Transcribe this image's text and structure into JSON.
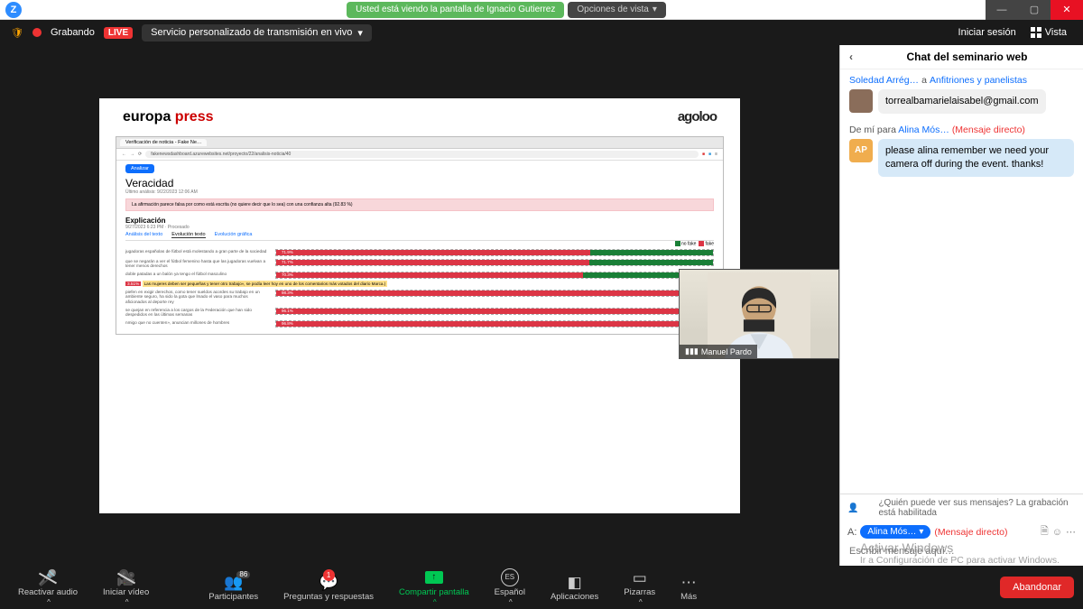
{
  "titlebar": {
    "logo_letter": "Z",
    "banner": "Usted está viendo la pantalla de Ignacio Gutierrez",
    "view_options": "Opciones de vista"
  },
  "toolbar": {
    "recording": "Grabando",
    "live": "LIVE",
    "stream_service": "Servicio personalizado de transmisión en vivo",
    "login": "Iniciar sesión",
    "view": "Vista"
  },
  "shared": {
    "logo_ep_a": "europa",
    "logo_ep_b": "press",
    "logo_agol": "agoloo",
    "browser_tab": "Verificación de noticia - Fake Ne…",
    "url": "fakenewsdashboard.azurewebsites.net/proyecto/22/analisis-noticia/40",
    "btn_analizar": "Analizar",
    "veracidad": "Veracidad",
    "veracidad_sub": "Último análisis: 9/22/2023 12:06 AM",
    "alert": "La afirmación parece falsa por como está escrita (no quiere decir que lo sea) con una confianza alta (92.83 %)",
    "explicacion": "Explicación",
    "exp_sub": "9/27/2023 6:23 PM · Procesado",
    "tab1": "Análisis del texto",
    "tab2": "Evolución texto",
    "tab3": "Evolución gráfica",
    "legend_no": "no fake",
    "legend_fake": "fake",
    "claims": [
      {
        "text": "jugadoras españolas de fútbol está molestando a gran parte de la sociedad",
        "red": 71.9,
        "label": "71.9%"
      },
      {
        "text": "que se negarán a ver el fútbol femenino hasta que las jugadoras vuelvan a tener menos derechos",
        "red": 71.7,
        "label": "71.7%"
      },
      {
        "text": "doble patadas a un balón ya tengo el fútbol masculino",
        "red": 70.3,
        "label": "70.3%"
      },
      {
        "text": "piefen en exigir derechos, como tener sueldos acordes su trabajo en un ambiente seguro, ha sido la gota que lmado el vaso para muchos aficionados al deporte rey",
        "red": 98.3,
        "label": "98.3%"
      },
      {
        "text": "se quejan en referencia a los cargos de la Federación que han sido despedidos en las últimas semanas",
        "red": 96.1,
        "label": "96.1%"
      },
      {
        "text": "nmigo que no cuenten», anuncian millones de hombres",
        "red": 96.8,
        "label": "96.8%"
      }
    ],
    "claim_highlight": "3.51% · Las mujeres deben ser pequeñas y tener otro trabajo», se podía leer hoy en uno de los comentarios más votados del diario Marca.)"
  },
  "camera": {
    "name": "Manuel Pardo"
  },
  "chat": {
    "title": "Chat del seminario web",
    "msg1_from": "Soledad Arrég…",
    "msg1_to_prefix": "a",
    "msg1_to": "Anfitriones y panelistas",
    "msg1_text": "torrealbamarielaisabel@gmail.com",
    "msg2_from": "De mí para",
    "msg2_to": "Alina Mós…",
    "msg2_dm": "(Mensaje directo)",
    "msg2_text": "please alina remember we need your camera off during the event. thanks!",
    "avatar2": "AP",
    "visibility": "¿Quién puede ver sus mensajes? La grabación está habilitada",
    "to_label": "A:",
    "to_target": "Alina Mós…",
    "to_dm": "(Mensaje directo)",
    "input_placeholder": "Escribir mensaje aquí…"
  },
  "controls": {
    "audio": "Reactivar audio",
    "video": "Iniciar vídeo",
    "participants": "Participantes",
    "participants_count": "86",
    "qa": "Preguntas y respuestas",
    "qa_badge": "1",
    "share": "Compartir pantalla",
    "lang": "Español",
    "lang_code": "ES",
    "apps": "Aplicaciones",
    "boards": "Pizarras",
    "more": "Más",
    "leave": "Abandonar"
  },
  "watermark": {
    "line1": "Activar Windows",
    "line2": "Ir a Configuración de PC para activar Windows."
  }
}
